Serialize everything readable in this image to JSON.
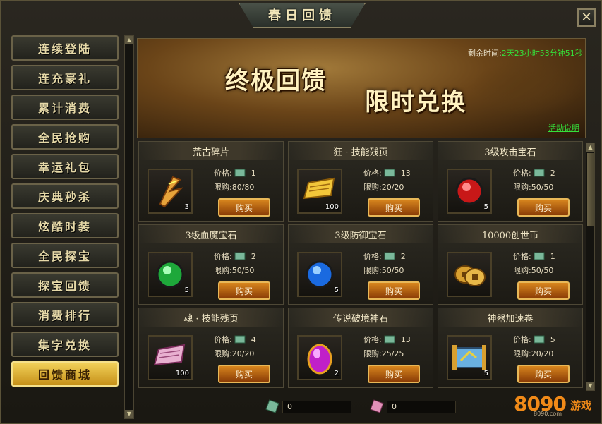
{
  "window": {
    "title": "春日回馈",
    "close": "✕"
  },
  "sidebar": {
    "items": [
      {
        "label": "连续登陆",
        "active": false
      },
      {
        "label": "连充豪礼",
        "active": false
      },
      {
        "label": "累计消费",
        "active": false
      },
      {
        "label": "全民抢购",
        "active": false
      },
      {
        "label": "幸运礼包",
        "active": false
      },
      {
        "label": "庆典秒杀",
        "active": false
      },
      {
        "label": "炫酷时装",
        "active": false
      },
      {
        "label": "全民探宝",
        "active": false
      },
      {
        "label": "探宝回馈",
        "active": false
      },
      {
        "label": "消费排行",
        "active": false
      },
      {
        "label": "集字兑换",
        "active": false
      },
      {
        "label": "回馈商城",
        "active": true
      }
    ]
  },
  "banner": {
    "title1": "终极回馈",
    "title2": "限时兑换",
    "timer_label": "剩余时间:",
    "timer_value": "2天23小时53分钟51秒",
    "event_link": "活动说明"
  },
  "shop": {
    "price_label": "价格:",
    "limit_label": "限购:",
    "buy_label": "购买",
    "items": [
      {
        "name": "荒古碎片",
        "icon": "ancient-shard-icon",
        "qty": "3",
        "price": "1",
        "limit": "80/80"
      },
      {
        "name": "狂 · 技能残页",
        "icon": "skill-page-gold-icon",
        "qty": "100",
        "price": "13",
        "limit": "20/20"
      },
      {
        "name": "3级攻击宝石",
        "icon": "red-gem-icon",
        "qty": "5",
        "price": "2",
        "limit": "50/50"
      },
      {
        "name": "3级血魔宝石",
        "icon": "green-gem-icon",
        "qty": "5",
        "price": "2",
        "limit": "50/50"
      },
      {
        "name": "3级防御宝石",
        "icon": "blue-gem-icon",
        "qty": "5",
        "price": "2",
        "limit": "50/50"
      },
      {
        "name": "10000创世币",
        "icon": "coins-icon",
        "qty": "",
        "price": "1",
        "limit": "50/50"
      },
      {
        "name": "魂 · 技能残页",
        "icon": "skill-page-purple-icon",
        "qty": "100",
        "price": "4",
        "limit": "20/20"
      },
      {
        "name": "传说破境神石",
        "icon": "purple-stone-icon",
        "qty": "2",
        "price": "13",
        "limit": "25/25"
      },
      {
        "name": "神器加速卷",
        "icon": "scroll-icon",
        "qty": "5",
        "price": "5",
        "limit": "20/20"
      }
    ]
  },
  "balances": [
    {
      "icon": "coupon-green-icon",
      "value": "0"
    },
    {
      "icon": "coupon-pink-icon",
      "value": "0"
    }
  ],
  "logo": {
    "number": "8090",
    "text": "游戏",
    "url": "8090.com"
  },
  "colors": {
    "accent_gold": "#f2d15a",
    "timer_green": "#35e03a",
    "button_orange": "#d8861e"
  }
}
